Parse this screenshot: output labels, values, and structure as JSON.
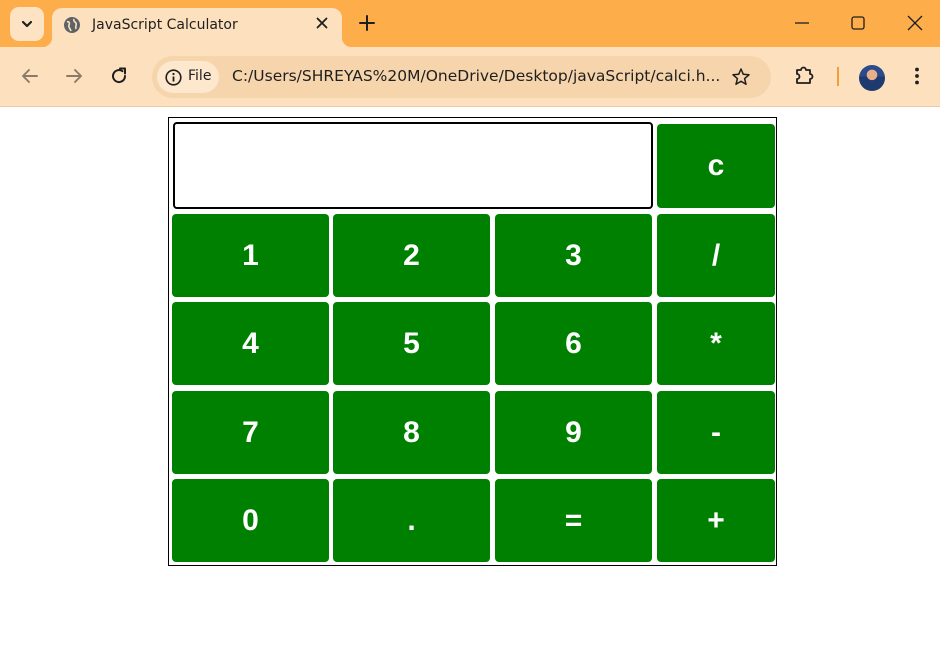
{
  "browser": {
    "tab_title": "JavaScript Calculator",
    "url": "C:/Users/SHREYAS%20M/OneDrive/Desktop/javaScript/calci.h...",
    "file_chip_label": "File",
    "colors": {
      "frame": "#fdae4a",
      "toolbar": "#fde0bd"
    }
  },
  "calculator": {
    "display_value": "",
    "clear_label": "c",
    "keys": [
      [
        "1",
        "2",
        "3",
        "/"
      ],
      [
        "4",
        "5",
        "6",
        "*"
      ],
      [
        "7",
        "8",
        "9",
        "-"
      ],
      [
        "0",
        ".",
        "=",
        "+"
      ]
    ],
    "colors": {
      "key_bg": "#008000",
      "key_text": "#ffffff"
    }
  }
}
